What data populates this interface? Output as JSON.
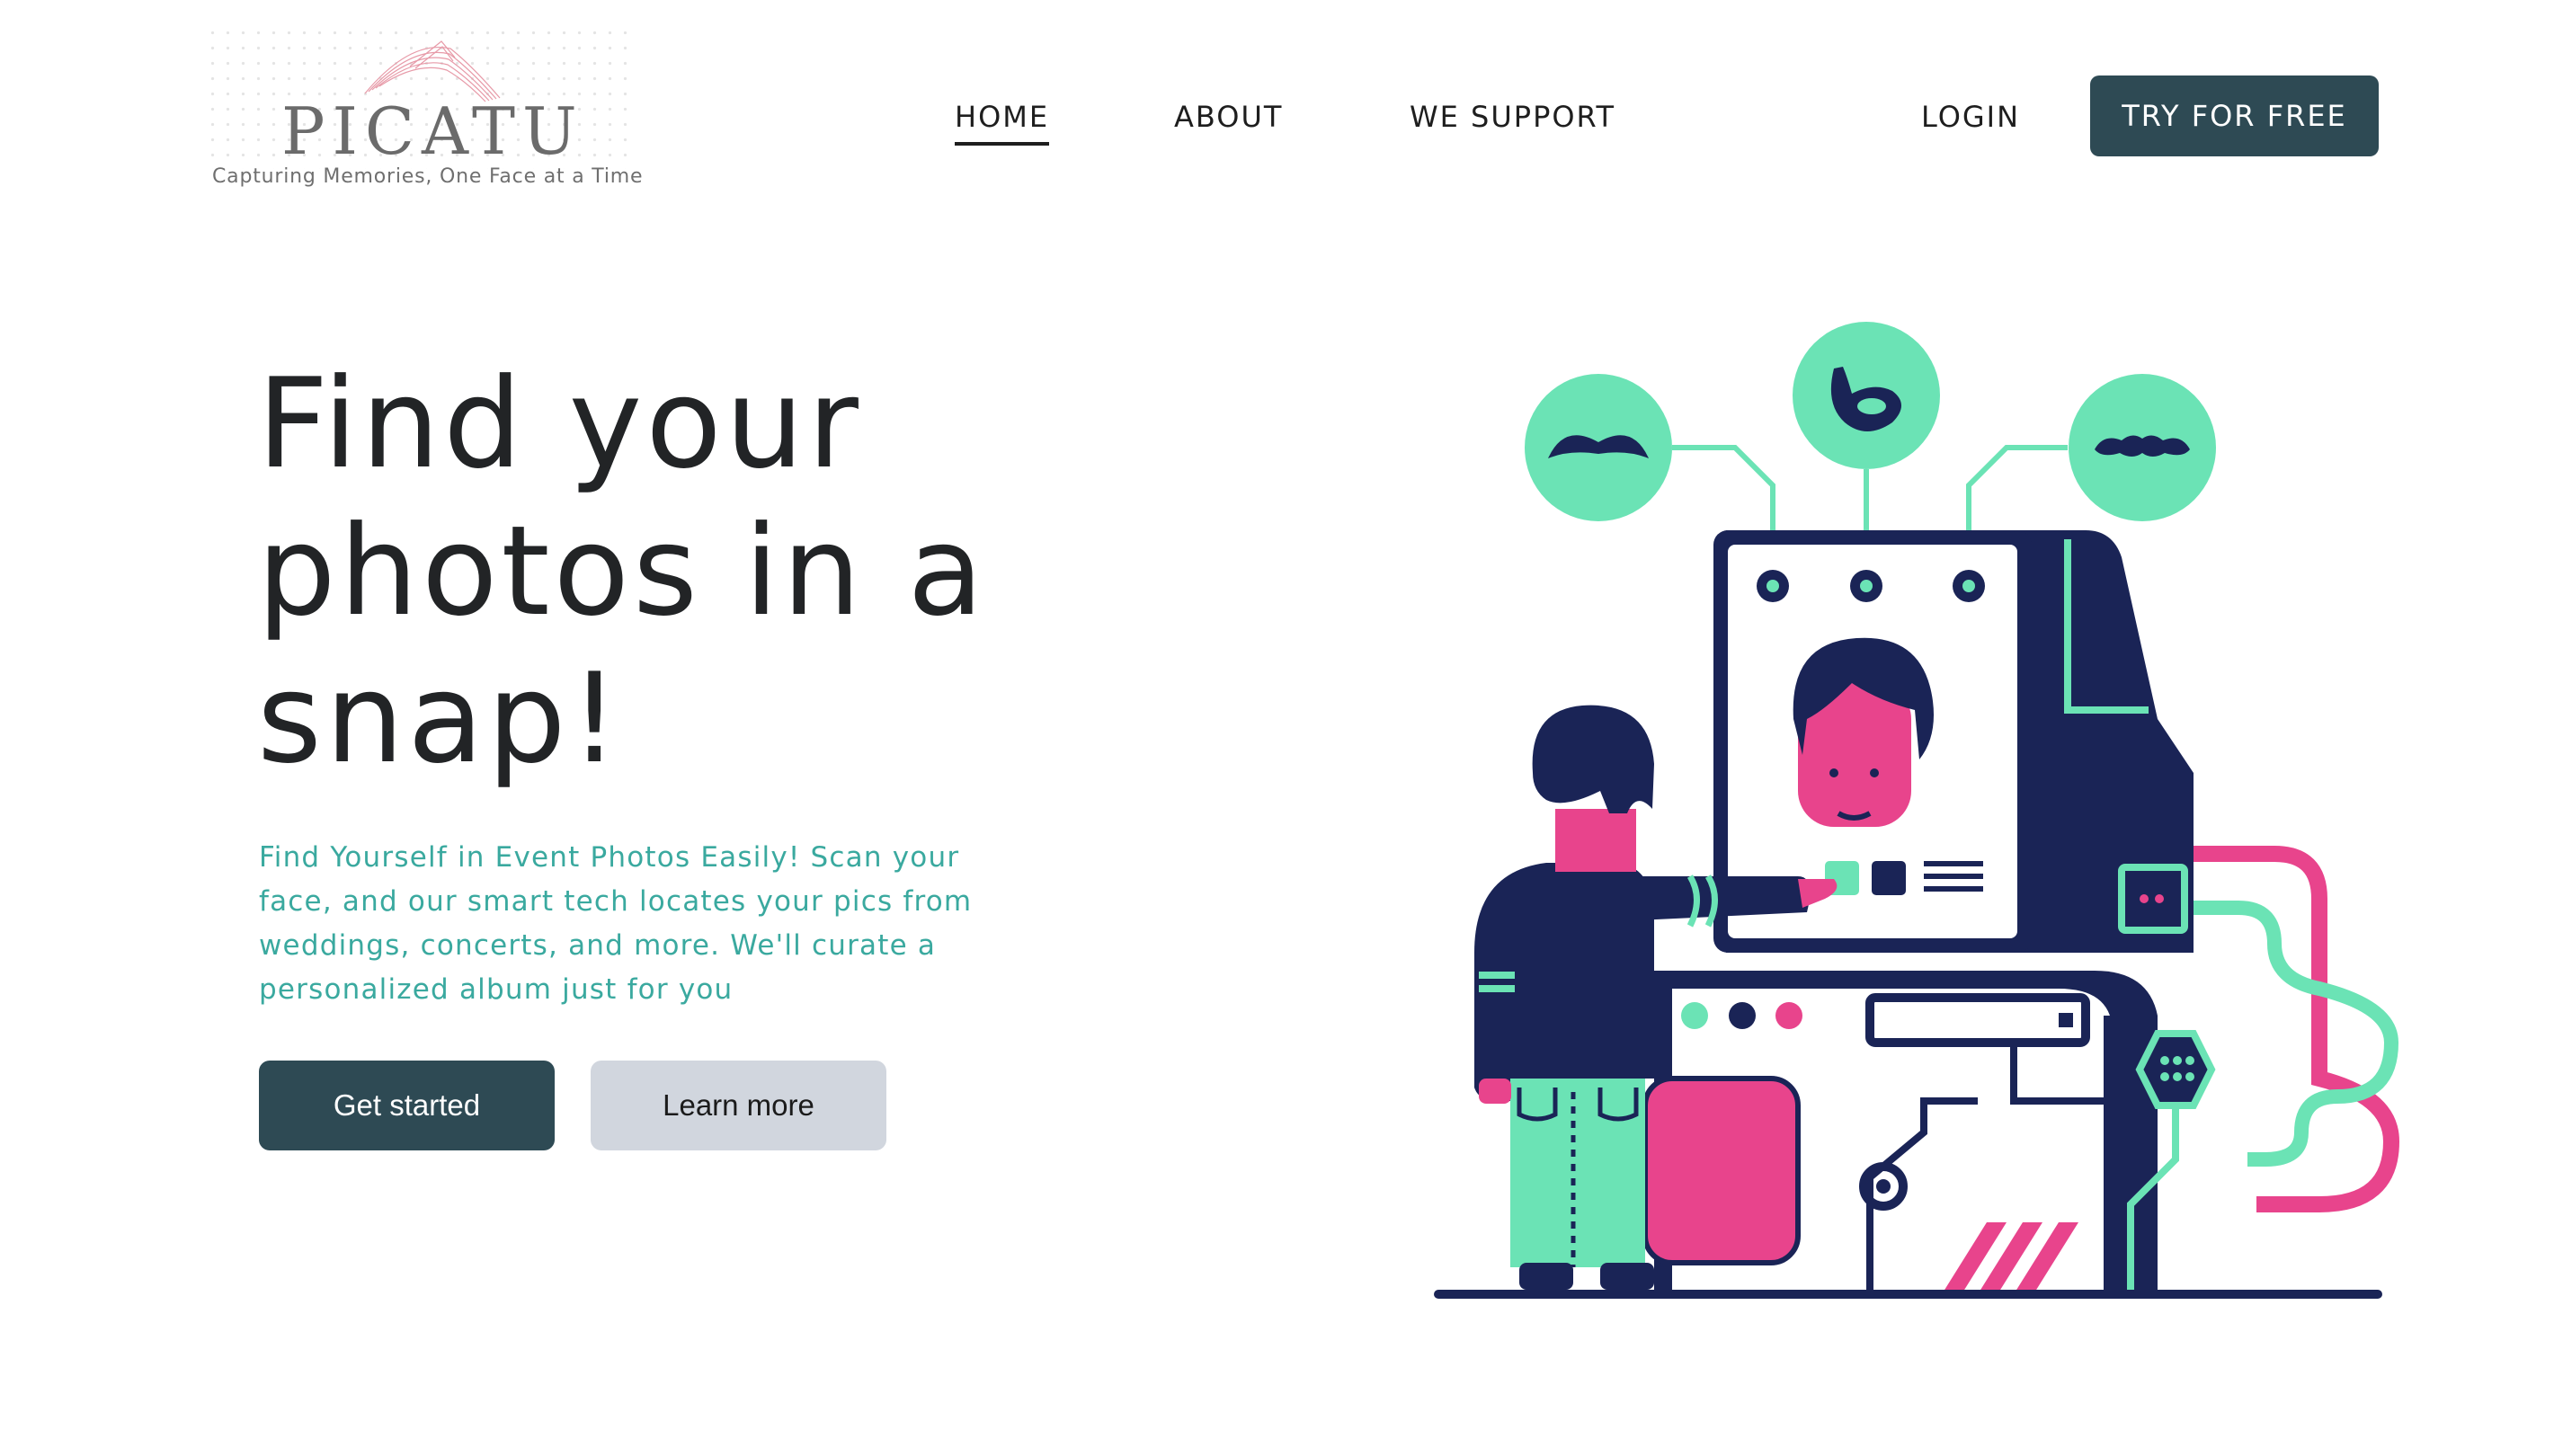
{
  "logo": {
    "name": "PICATU",
    "tagline": "Capturing Memories, One Face at a Time"
  },
  "nav": {
    "items": [
      {
        "label": "HOME",
        "active": true
      },
      {
        "label": "ABOUT",
        "active": false
      },
      {
        "label": "WE SUPPORT",
        "active": false
      }
    ],
    "login": "LOGIN",
    "cta": "TRY FOR FREE"
  },
  "hero": {
    "title_line1": "Find your",
    "title_line2": "photos in a",
    "title_line3": "snap!",
    "subtitle": "Find Yourself in Event Photos Easily! Scan your face, and our smart tech locates your pics from weddings, concerts, and more. We'll curate a personalized album just for you",
    "primary_button": "Get started",
    "secondary_button": "Learn more"
  },
  "colors": {
    "accent": "#2e4a54",
    "subtitle": "#3aa99f",
    "navy": "#1a2456",
    "mint": "#6be3b5",
    "pink": "#e8448c"
  },
  "illustration": {
    "icons": [
      "mustache-icon",
      "goatee-icon",
      "mustache-curly-icon"
    ]
  }
}
